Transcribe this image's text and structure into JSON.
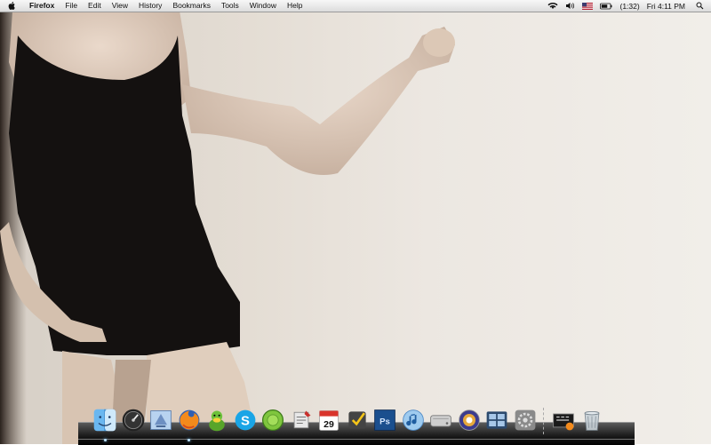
{
  "menubar": {
    "app_name": "Firefox",
    "menus": [
      "File",
      "Edit",
      "View",
      "History",
      "Bookmarks",
      "Tools",
      "Window",
      "Help"
    ],
    "battery_text": "(1:32)",
    "clock": "Fri 4:11 PM",
    "status_icons": [
      "wifi-icon",
      "volume-icon",
      "us-flag-icon",
      "battery-icon",
      "spotlight-icon"
    ]
  },
  "dock": {
    "items": [
      {
        "name": "finder",
        "running": true
      },
      {
        "name": "dashboard",
        "running": false
      },
      {
        "name": "mail",
        "running": false
      },
      {
        "name": "firefox",
        "running": true
      },
      {
        "name": "adium",
        "running": false
      },
      {
        "name": "skype",
        "running": false
      },
      {
        "name": "growl",
        "running": false
      },
      {
        "name": "script-editor",
        "running": false
      },
      {
        "name": "ical",
        "running": false,
        "label": "29"
      },
      {
        "name": "things",
        "running": false
      },
      {
        "name": "photoshop",
        "running": false,
        "label": "Ps"
      },
      {
        "name": "itunes",
        "running": false
      },
      {
        "name": "disk-utility",
        "running": false
      },
      {
        "name": "ilife-media",
        "running": false
      },
      {
        "name": "spaces",
        "running": false
      },
      {
        "name": "system-preferences",
        "running": false
      }
    ],
    "right_items": [
      {
        "name": "downloads-stack"
      },
      {
        "name": "trash"
      }
    ]
  },
  "colors": {
    "menubar_bg": "#e8e8e8",
    "dock_shelf": "#1a1a1a"
  }
}
